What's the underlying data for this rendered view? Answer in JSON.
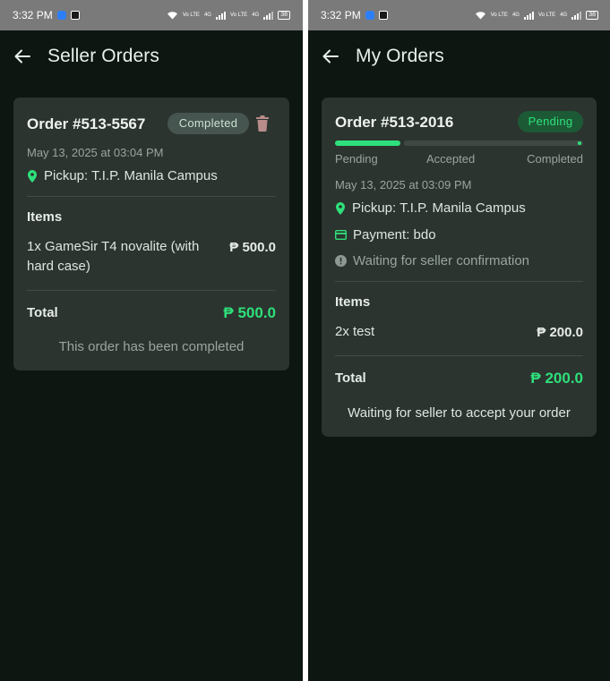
{
  "colors": {
    "background": "#0d1611",
    "card": "#2c342f",
    "accent": "#2ee07b",
    "status_bar": "#7a7a7a",
    "delete_icon": "#b88c8a"
  },
  "left_screen": {
    "status_bar": {
      "time": "3:32 PM",
      "battery": "38",
      "net1": "Vo LTE",
      "net2": "4G",
      "net3": "Vo LTE",
      "net4": "4G"
    },
    "title": "Seller Orders",
    "order": {
      "title": "Order #513-5567",
      "status": "Completed",
      "date": "May 13, 2025 at 03:04 PM",
      "pickup": "Pickup: T.I.P. Manila Campus",
      "items_heading": "Items",
      "items": [
        {
          "name": "1x GameSir T4 novalite (with hard case)",
          "price": "₱ 500.0"
        }
      ],
      "total_label": "Total",
      "total_value": "₱ 500.0",
      "footer": "This order has been completed"
    }
  },
  "right_screen": {
    "status_bar": {
      "time": "3:32 PM",
      "battery": "38",
      "net1": "Vo LTE",
      "net2": "4G",
      "net3": "Vo LTE",
      "net4": "4G"
    },
    "title": "My Orders",
    "order": {
      "title": "Order #513-2016",
      "status": "Pending",
      "progress": {
        "steps": [
          "Pending",
          "Accepted",
          "Completed"
        ],
        "current_step": 1
      },
      "date": "May 13, 2025 at 03:09 PM",
      "pickup": "Pickup: T.I.P. Manila Campus",
      "payment": "Payment: bdo",
      "notice": "Waiting for seller confirmation",
      "items_heading": "Items",
      "items": [
        {
          "name": "2x test",
          "price": "₱ 200.0"
        }
      ],
      "total_label": "Total",
      "total_value": "₱ 200.0",
      "footer": "Waiting for seller to accept your order"
    }
  }
}
